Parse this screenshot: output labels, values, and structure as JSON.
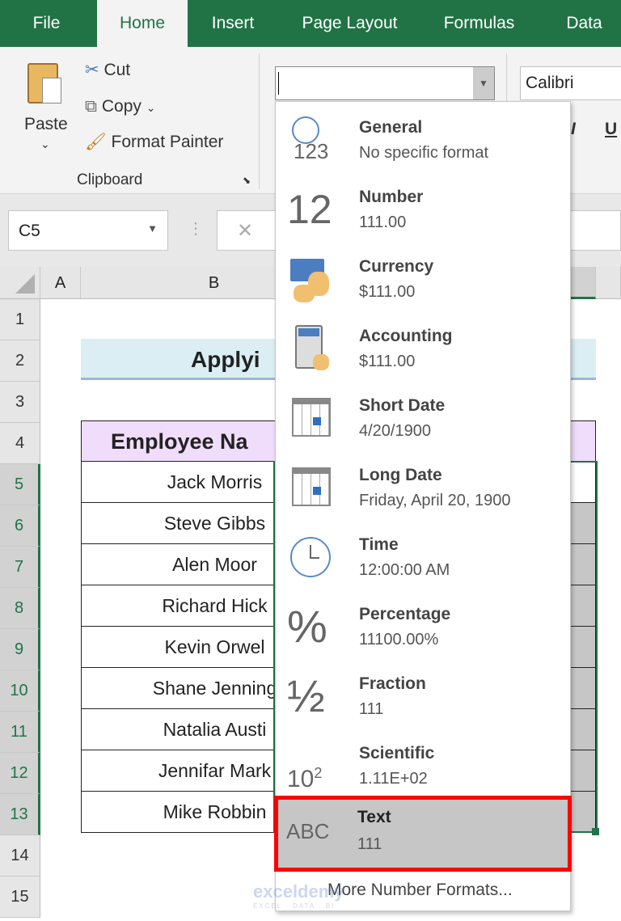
{
  "tabs": [
    "File",
    "Home",
    "Insert",
    "Page Layout",
    "Formulas",
    "Data"
  ],
  "ribbon": {
    "paste": "Paste",
    "cut": "Cut",
    "copy": "Copy",
    "format_painter": "Format Painter",
    "clipboard": "Clipboard",
    "number_format_value": "",
    "font": "Calibri",
    "italic": "I",
    "underline": "U"
  },
  "formula_bar": {
    "name_box": "C5",
    "cancel": "✕"
  },
  "columns": [
    "A",
    "B"
  ],
  "rows": [
    "1",
    "2",
    "3",
    "4",
    "5",
    "6",
    "7",
    "8",
    "9",
    "10",
    "11",
    "12",
    "13",
    "14",
    "15"
  ],
  "sheet": {
    "title": "Applyi",
    "header": "Employee Na",
    "names": [
      "Jack Morris",
      "Steve Gibbs",
      "Alen Moor",
      "Richard Hick",
      "Kevin Orwel",
      "Shane Jenning",
      "Natalia Austi",
      "Jennifar Mark",
      "Mike Robbin"
    ]
  },
  "dropdown": {
    "items": [
      {
        "title": "General",
        "sample": "No specific format",
        "icon": "clock-123-icon"
      },
      {
        "title": "Number",
        "sample": "111.00",
        "icon": "number-12-icon"
      },
      {
        "title": "Currency",
        "sample": "$111.00",
        "icon": "currency-icon"
      },
      {
        "title": "Accounting",
        "sample": " $111.00",
        "icon": "accounting-icon"
      },
      {
        "title": "Short Date",
        "sample": "4/20/1900",
        "icon": "calendar-icon"
      },
      {
        "title": "Long Date",
        "sample": "Friday, April 20, 1900",
        "icon": "calendar-icon"
      },
      {
        "title": "Time",
        "sample": "12:00:00 AM",
        "icon": "clock-icon"
      },
      {
        "title": "Percentage",
        "sample": "11100.00%",
        "icon": "percent-icon"
      },
      {
        "title": "Fraction",
        "sample": "111",
        "icon": "fraction-icon"
      },
      {
        "title": "Scientific",
        "sample": "1.11E+02",
        "icon": "scientific-icon"
      },
      {
        "title": "Text",
        "sample": "111",
        "icon": "abc-icon"
      }
    ],
    "more": "More Number Formats...",
    "glyphs": {
      "n12": "12",
      "pct": "%",
      "frac": "½",
      "sci": "10",
      "sup": "2",
      "abc": "ABC",
      "g123": "123"
    }
  },
  "watermark": {
    "name": "exceldemy",
    "tag": "EXCEL · DATA · BI"
  },
  "colors": {
    "excel_green": "#217346",
    "highlight": "#ff0000",
    "selected_item": "#c6c6c6"
  }
}
